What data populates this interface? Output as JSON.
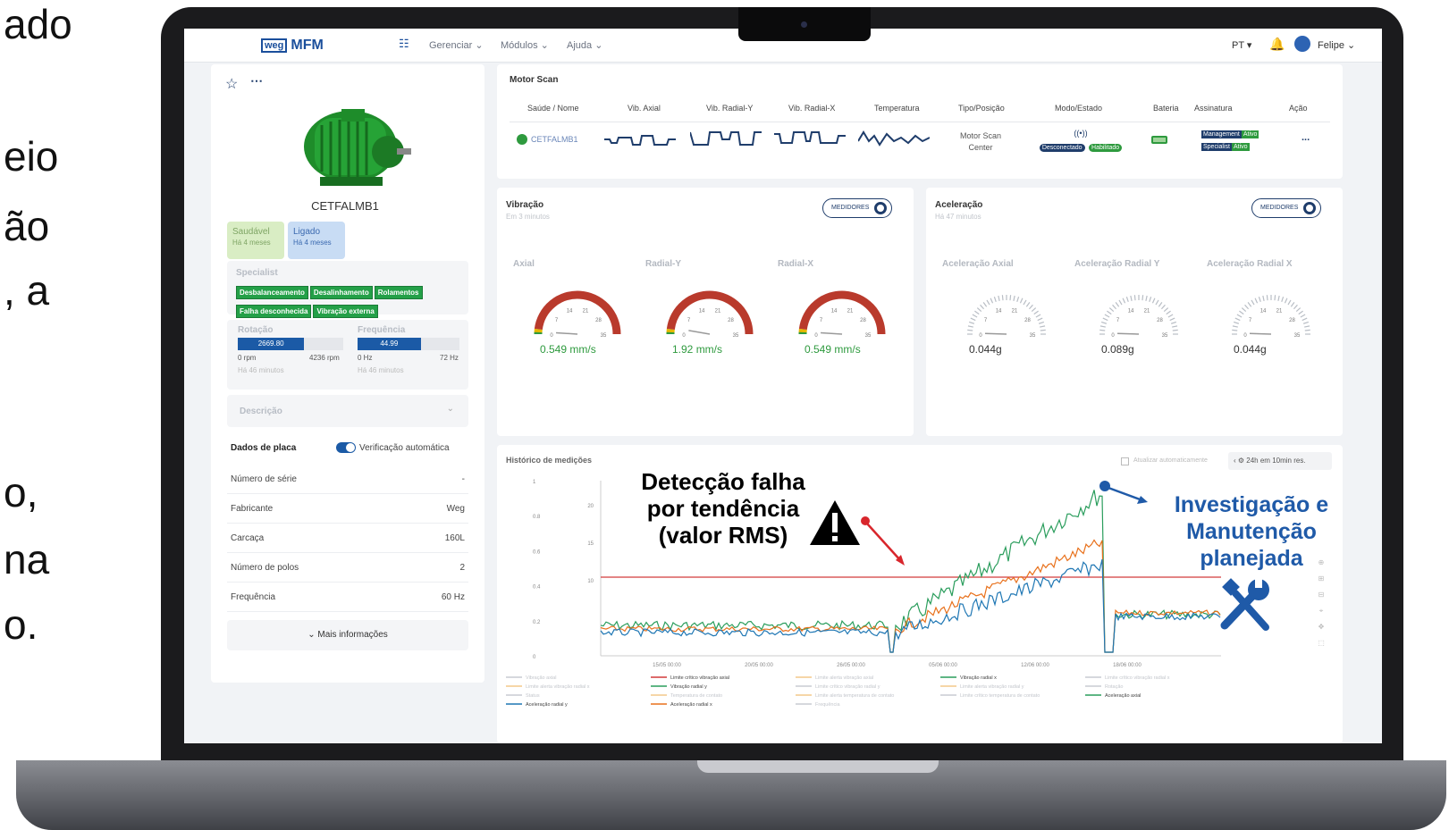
{
  "slide_text": [
    "ado",
    "eio",
    "ão",
    ", a",
    "o,",
    "na",
    "o."
  ],
  "nav": {
    "logo_mark": "weg",
    "logo_text": "MFM",
    "menu": [
      "Gerenciar",
      "Módulos",
      "Ajuda"
    ],
    "lang": "PT",
    "user": "Felipe"
  },
  "asset": {
    "name": "CETFALMB1",
    "status_tiles": [
      {
        "title": "Saudável",
        "sub": "Há 4 meses"
      },
      {
        "title": "Ligado",
        "sub": "Há 4 meses"
      }
    ],
    "specialist_title": "Specialist",
    "tags": [
      "Desbalanceamento",
      "Desalinhamento",
      "Rolamentos",
      "Falha desconhecida",
      "Vibração externa"
    ],
    "rotation": {
      "title": "Rotação",
      "value": "2669.80",
      "min": "0 rpm",
      "max": "4236 rpm",
      "ago": "Há 46 minutos",
      "fill": 0.63
    },
    "frequency": {
      "title": "Frequência",
      "value": "44.99",
      "min": "0 Hz",
      "max": "72 Hz",
      "ago": "Há 46 minutos",
      "fill": 0.62
    },
    "description": "Descrição",
    "plate_title": "Dados de placa",
    "auto_verify": "Verificação automática",
    "plate_rows": [
      {
        "k": "Número de série",
        "v": "-"
      },
      {
        "k": "Fabricante",
        "v": "Weg"
      },
      {
        "k": "Carcaça",
        "v": "160L"
      },
      {
        "k": "Número de polos",
        "v": "2"
      },
      {
        "k": "Frequência",
        "v": "60 Hz"
      }
    ],
    "more_info": "Mais informações"
  },
  "motor_scan": {
    "title": "Motor Scan",
    "headers": [
      "Saúde / Nome",
      "Vib. Axial",
      "Vib. Radial-Y",
      "Vib. Radial-X",
      "Temperatura",
      "Tipo/Posição",
      "Modo/Estado",
      "Bateria",
      "Assinatura",
      "Ação"
    ],
    "name": "CETFALMB1",
    "tipo": [
      "Motor Scan",
      "Center"
    ],
    "modo_badges": [
      "Desconectado",
      "Habilitado"
    ],
    "assinatura": [
      {
        "plan": "Management",
        "state": "Ativo"
      },
      {
        "plan": "Specialist",
        "state": "Ativo"
      }
    ],
    "action": "..."
  },
  "vibration": {
    "title": "Vibração",
    "ago": "Em 3 minutos",
    "toggle": "MEDIDORES",
    "gauges": [
      {
        "label": "Axial",
        "value": "0.549 mm/s",
        "level": 0.02
      },
      {
        "label": "Radial-Y",
        "value": "1.92 mm/s",
        "level": 0.055
      },
      {
        "label": "Radial-X",
        "value": "0.549 mm/s",
        "level": 0.02
      }
    ],
    "ticks": [
      "0",
      "7",
      "14",
      "21",
      "28",
      "35"
    ]
  },
  "acceleration": {
    "title": "Aceleração",
    "ago": "Há 47 minutos",
    "toggle": "MEDIDORES",
    "gauges": [
      {
        "label": "Aceleração Axial",
        "value": "0.044g"
      },
      {
        "label": "Aceleração Radial Y",
        "value": "0.089g"
      },
      {
        "label": "Aceleração Radial X",
        "value": "0.044g"
      }
    ],
    "ticks": [
      "0",
      "7",
      "14",
      "21",
      "28",
      "35"
    ]
  },
  "history": {
    "title": "Histórico de medições",
    "check_label": "Atualizar automaticamente",
    "range_label": "24h em 10min res.",
    "y_left_ticks": [
      "1",
      "0.8",
      "0.6",
      "0.4",
      "0.2",
      "0"
    ],
    "y_mid_ticks": [
      "20",
      "15",
      "10"
    ],
    "x_ticks": [
      "15/05 00:00",
      "20/05 00:00",
      "26/05 00:00",
      "05/06 00:00",
      "12/06 00:00",
      "18/06 00:00"
    ],
    "legend": [
      "Vibração axial",
      "Limite crítico vibração axial",
      "Limite alerta vibração axial",
      "Vibração radial x",
      "Limite crítico vibração radial x",
      "Limite alerta vibração radial x",
      "Vibração radial y",
      "Limite crítico vibração radial y",
      "Limite alerta vibração radial y",
      "Rotação",
      "Status",
      "Temperatura de contato",
      "Limite alerta temperatura de contato",
      "Limite crítico temperatura de contato",
      "Aceleração axial",
      "Aceleração radial y",
      "Aceleração radial x",
      "Frequência"
    ]
  },
  "annotations": {
    "detection": [
      "Detecção falha",
      "por tendência",
      "(valor RMS)"
    ],
    "investigation": [
      "Investigação e",
      "Manutenção",
      "planejada"
    ]
  },
  "colors": {
    "brand": "#1b4f9c",
    "green": "#2e9a3e",
    "blue_series": "#1f77b4",
    "orange_series": "#e8711c",
    "teal_series": "#2a9d5c",
    "alarm_red": "#d23a3a",
    "annot_blue": "#1f5aa8"
  }
}
